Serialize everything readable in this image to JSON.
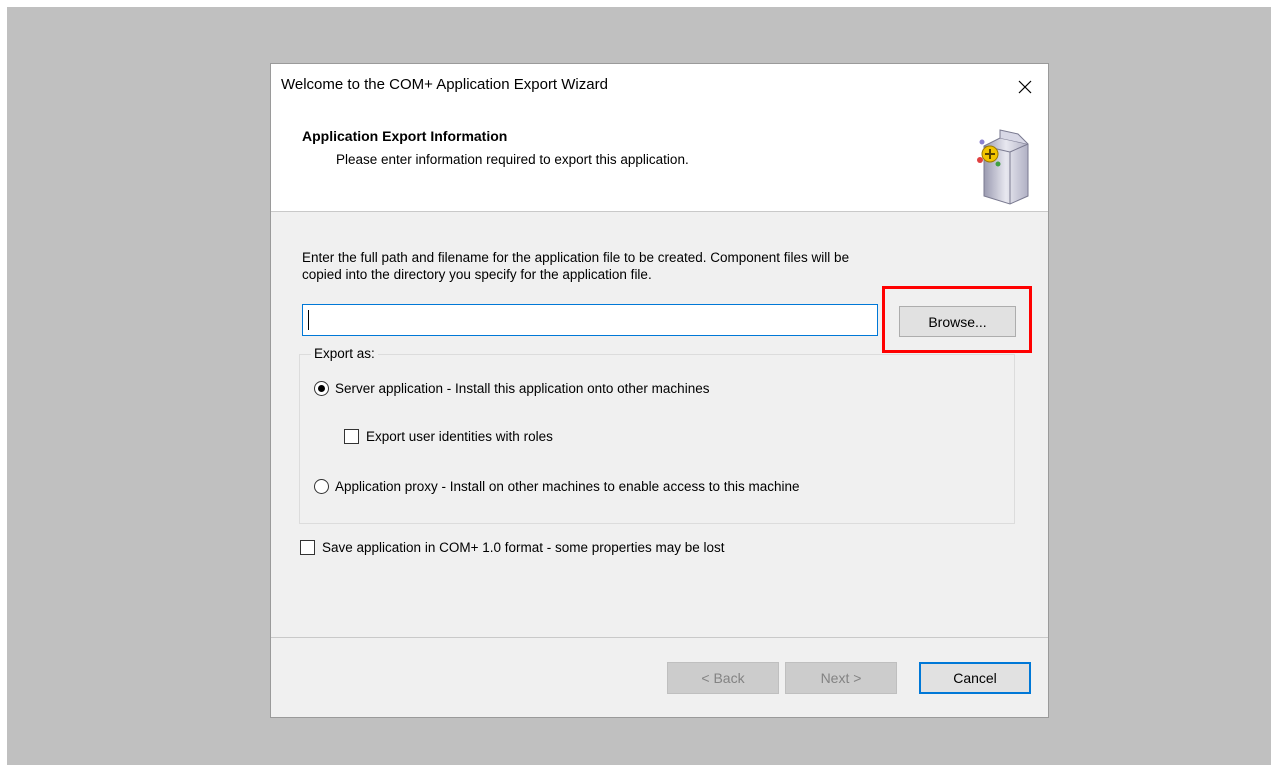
{
  "window": {
    "title": "Welcome to the COM+ Application Export Wizard"
  },
  "header": {
    "title": "Application Export Information",
    "subtitle": "Please enter information required to export this application.",
    "icon": "com-package-icon"
  },
  "form": {
    "instructions_line1": "Enter the full path and filename for the application file to be created.  Component files will be",
    "instructions_line2": "copied into the directory you specify for the application file.",
    "path_value": "",
    "browse_label": "Browse..."
  },
  "export_as": {
    "label": "Export as:",
    "server_option": "Server application - Install this application onto other machines",
    "server_selected": true,
    "export_identities": "Export user identities with roles",
    "export_identities_checked": false,
    "proxy_option": "Application proxy - Install on other machines to enable access to this machine",
    "proxy_selected": false
  },
  "save_format": {
    "label": "Save application in COM+ 1.0 format - some properties may be lost",
    "checked": false
  },
  "buttons": {
    "back": "< Back",
    "next": "Next >",
    "cancel": "Cancel"
  },
  "colors": {
    "highlight": "#ff0000",
    "focus": "#0078d7",
    "backdrop": "#c0c0c0"
  }
}
